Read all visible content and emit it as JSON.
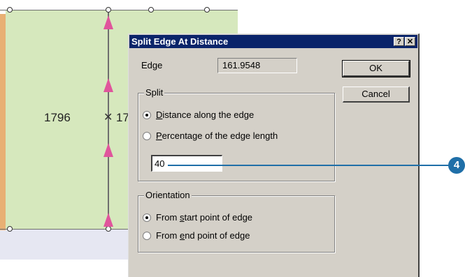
{
  "map": {
    "parcel_label": "1796",
    "partial_label": "17"
  },
  "dialog": {
    "title": "Split Edge At Distance",
    "help_button": "?",
    "close_button": "✕",
    "edge_label": "Edge",
    "edge_value": "161.9548",
    "ok_label": "OK",
    "cancel_label": "Cancel",
    "split_group_title": "Split",
    "split_option_distance_prefix": "",
    "split_option_distance_mnemonic": "D",
    "split_option_distance_rest": "istance along the edge",
    "split_option_percentage_mnemonic": "P",
    "split_option_percentage_rest": "ercentage of the edge length",
    "split_selected": "distance",
    "split_value": "40",
    "orientation_group_title": "Orientation",
    "orientation_start_prefix": "From ",
    "orientation_start_mnemonic": "s",
    "orientation_start_rest": "tart point of edge",
    "orientation_end_prefix": "From ",
    "orientation_end_mnemonic": "e",
    "orientation_end_rest": "nd point of edge",
    "orientation_selected": "start"
  },
  "callout": {
    "number": "4",
    "color": "#1f6fa8"
  }
}
